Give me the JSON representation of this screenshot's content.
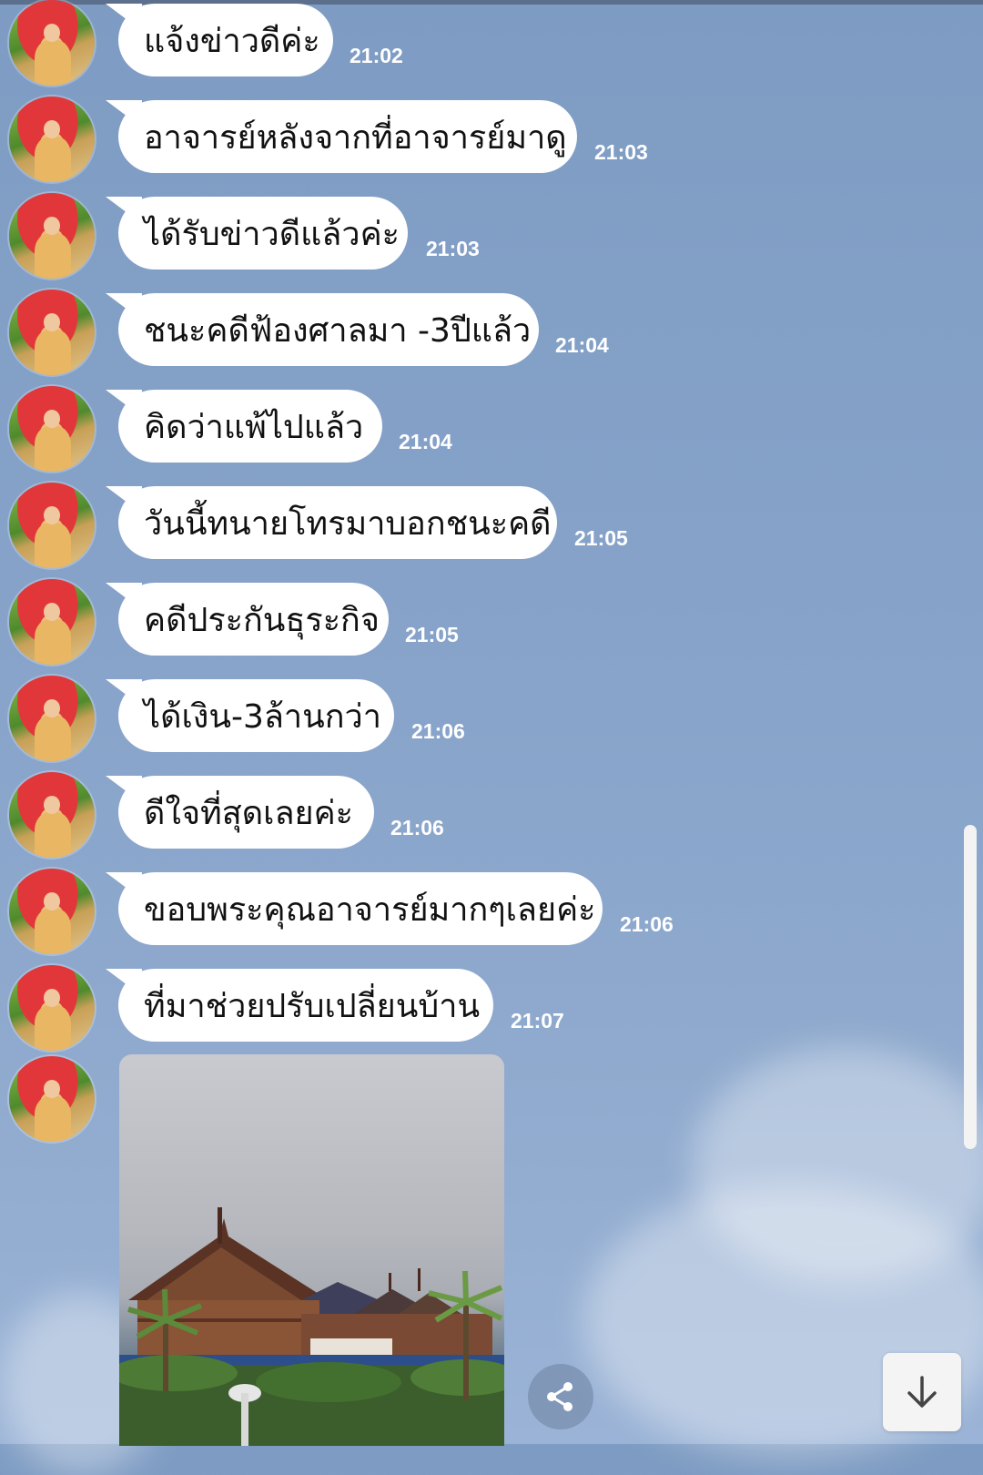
{
  "messages": [
    {
      "text": "แจ้งข่าวดีค่ะ",
      "time": "21:02"
    },
    {
      "text": "อาจารย์หลังจากที่อาจารย์มาดู",
      "time": "21:03"
    },
    {
      "text": "ได้รับข่าวดีแล้วค่ะ",
      "time": "21:03"
    },
    {
      "text": "ชนะคดีฟ้องศาลมา -3ปีแล้ว",
      "time": "21:04"
    },
    {
      "text": "คิดว่าแพ้ไปแล้ว",
      "time": "21:04"
    },
    {
      "text": "วันนี้ทนายโทรมาบอกชนะคดี",
      "time": "21:05"
    },
    {
      "text": "คดีประกันธุระกิจ",
      "time": "21:05"
    },
    {
      "text": "ได้เงิน-3ล้านกว่า",
      "time": "21:06"
    },
    {
      "text": "ดีใจที่สุดเลยค่ะ",
      "time": "21:06"
    },
    {
      "text": "ขอบพระคุณอาจารย์มากๆเลยค่ะ",
      "time": "21:06"
    },
    {
      "text": "ที่มาช่วยปรับเปลี่ยนบ้าน",
      "time": "21:07"
    }
  ],
  "icons": {
    "avatar": "profile-avatar",
    "share": "share-icon",
    "scroll_down": "arrow-down-icon"
  },
  "colors": {
    "background": "#86a2c9",
    "bubble": "#ffffff",
    "time_text": "#ffffff"
  }
}
